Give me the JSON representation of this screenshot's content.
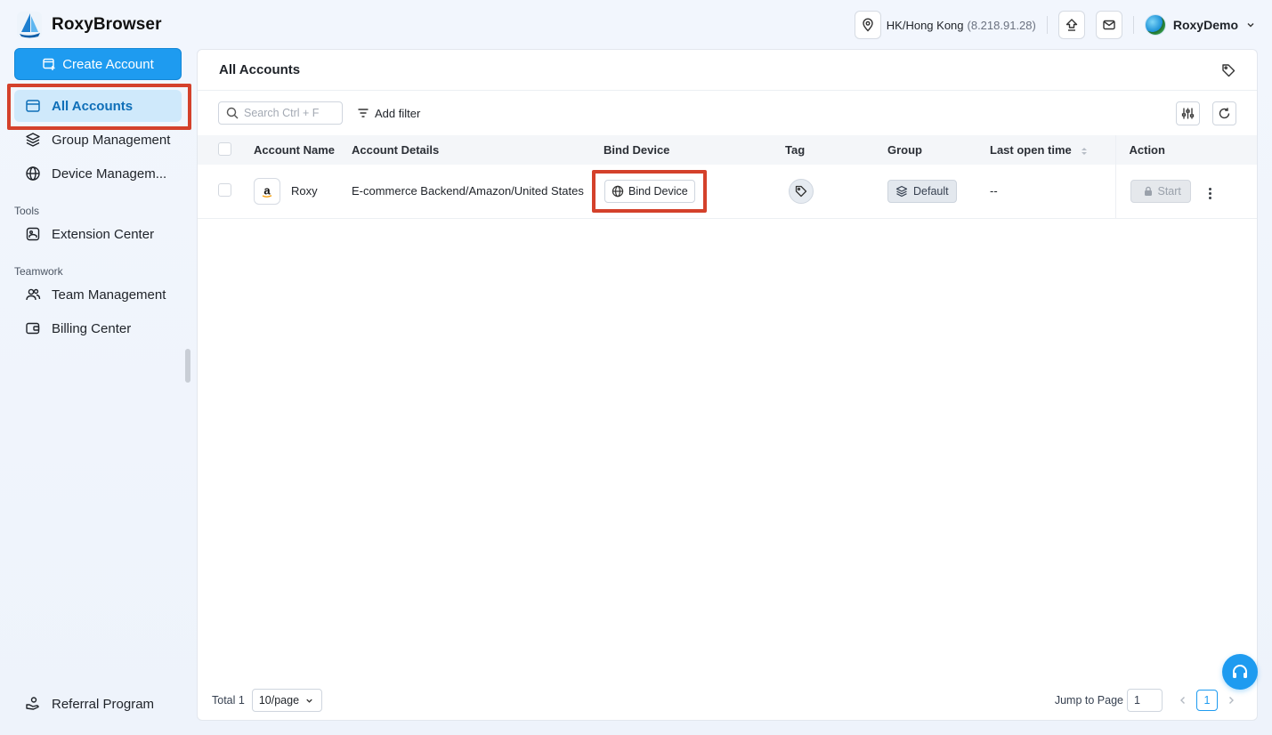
{
  "app": {
    "name": "RoxyBrowser"
  },
  "topbar": {
    "location": "HK/Hong Kong",
    "ip": "(8.218.91.28)",
    "upload_icon": "upload-icon",
    "mail_icon": "mail-icon",
    "user_name": "RoxyDemo"
  },
  "sidebar": {
    "create_button": "Create Account",
    "items": [
      {
        "label": "All Accounts",
        "icon": "window-icon",
        "active": true
      },
      {
        "label": "Group Management",
        "icon": "layers-icon"
      },
      {
        "label": "Device Managem...",
        "icon": "globe-icon"
      }
    ],
    "tools_heading": "Tools",
    "tools": [
      {
        "label": "Extension Center",
        "icon": "extension-icon"
      }
    ],
    "teamwork_heading": "Teamwork",
    "teamwork": [
      {
        "label": "Team Management",
        "icon": "team-icon"
      },
      {
        "label": "Billing Center",
        "icon": "wallet-icon"
      }
    ],
    "referral": "Referral Program"
  },
  "main": {
    "title": "All Accounts",
    "search_placeholder": "Search Ctrl + F",
    "add_filter": "Add filter",
    "columns": {
      "account_name": "Account Name",
      "account_details": "Account Details",
      "bind_device": "Bind Device",
      "tag": "Tag",
      "group": "Group",
      "last_open": "Last open time",
      "action": "Action"
    },
    "rows": [
      {
        "platform_logo": "a",
        "name": "Roxy",
        "details": "E-commerce Backend/Amazon/United States",
        "bind_label": "Bind Device",
        "group": "Default",
        "last_open": "--",
        "start_label": "Start"
      }
    ],
    "footer": {
      "total": "Total 1",
      "page_size": "10/page",
      "jump_label": "Jump to Page",
      "jump_value": "1",
      "current_page": "1"
    }
  },
  "colors": {
    "accent": "#1e9bf0",
    "highlight": "#d4412b",
    "active_bg": "#cfe9fb"
  }
}
